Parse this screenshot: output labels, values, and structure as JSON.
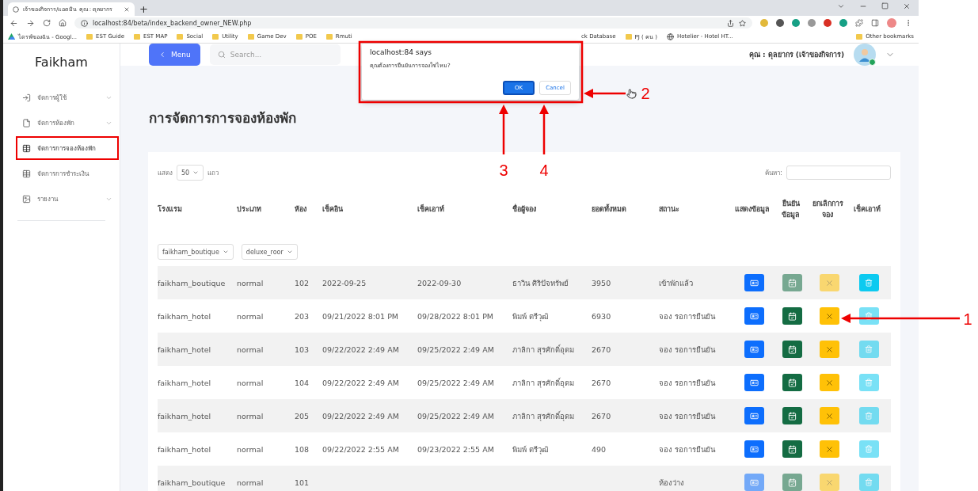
{
  "browser": {
    "tab_title": "เจ้าของกิจการ/แอดมิน คุณ : ดุลยากร",
    "new_tab": "+",
    "url": "localhost:84/beta/index_backend_owner_NEW.php",
    "bookmarks_left": [
      {
        "kind": "drive",
        "label": "ไดรฟ์ของฉัน - Googl..."
      },
      {
        "kind": "folder",
        "label": "EST Guide"
      },
      {
        "kind": "folder",
        "label": "EST MAP"
      },
      {
        "kind": "folder",
        "label": "Social"
      },
      {
        "kind": "folder",
        "label": "Utility"
      },
      {
        "kind": "folder",
        "label": "Game Dev"
      },
      {
        "kind": "folder",
        "label": "POE"
      },
      {
        "kind": "folder",
        "label": "Rmuti"
      }
    ],
    "bookmarks_right": [
      {
        "kind": "plain",
        "label": "ck Database"
      },
      {
        "kind": "folder",
        "label": "PJ ( คน )"
      },
      {
        "kind": "globe",
        "label": "Hotelier - Hotel HT..."
      }
    ],
    "other_bookmarks": "Other bookmarks"
  },
  "sidebar": {
    "brand": "Faikham",
    "items": [
      {
        "kind": "login",
        "label": "จัดการผู้ใช้",
        "has_submenu": true,
        "selected": false
      },
      {
        "kind": "file",
        "label": "จัดการห้องพัก",
        "has_submenu": true,
        "selected": false
      },
      {
        "kind": "table",
        "label": "จัดการการจองห้องพัก",
        "has_submenu": false,
        "selected": true
      },
      {
        "kind": "table",
        "label": "จัดการการชำระเงิน",
        "has_submenu": false,
        "selected": false
      },
      {
        "kind": "report",
        "label": "รายงาน",
        "has_submenu": true,
        "selected": false
      }
    ]
  },
  "topbar": {
    "menu_button": "Menu",
    "search_placeholder": "Search...",
    "user": "คุณ : ดุลยากร (เจ้าของกิจการ)"
  },
  "page_title": "การจัดการการจองห้องพัก",
  "table_controls": {
    "show_label": "แสดง",
    "page_size": "50",
    "rows_label": "แถว",
    "search_label": "ค้นหา:"
  },
  "table": {
    "columns": [
      "โรงแรม",
      "ประเภท",
      "ห้อง",
      "เช็คอิน",
      "เช็คเอาท์",
      "ชื่อผู้จอง",
      "ยอดทั้งหมด",
      "สถานะ",
      "แสดงข้อมูล",
      "ยืนยันข้อมูล",
      "ยกเลิกการจอง",
      "เช็คเอาท์"
    ],
    "filters": [
      "faikham_boutique",
      "deluxe_roor"
    ],
    "rows": [
      {
        "hotel": "faikham_boutique",
        "type": "normal",
        "room": "102",
        "check_in": "2022-09-25",
        "check_out": "2022-09-30",
        "guest": "ธาวิน ศิริปัจทรัพย์",
        "total": "3950",
        "status": "เข้าพักแล้ว",
        "actions": [
          {
            "kind": "view",
            "disabled": false
          },
          {
            "kind": "confirm",
            "disabled": true
          },
          {
            "kind": "cancel",
            "disabled": true
          },
          {
            "kind": "delete",
            "disabled": false
          }
        ]
      },
      {
        "hotel": "faikham_hotel",
        "type": "normal",
        "room": "203",
        "check_in": "09/21/2022 8:01 PM",
        "check_out": "09/28/2022 8:01 PM",
        "guest": "พิมพ์ ตรีวุฒิ",
        "total": "6930",
        "status": "จอง รอการยืนยัน",
        "actions": [
          {
            "kind": "view",
            "disabled": false
          },
          {
            "kind": "confirm",
            "disabled": false
          },
          {
            "kind": "cancel",
            "disabled": false
          },
          {
            "kind": "delete",
            "disabled": true
          }
        ]
      },
      {
        "hotel": "faikham_hotel",
        "type": "normal",
        "room": "103",
        "check_in": "09/22/2022 2:49 AM",
        "check_out": "09/25/2022 2:49 AM",
        "guest": "ภาลิกา สุรศักดิ์อุดม",
        "total": "2670",
        "status": "จอง รอการยืนยัน",
        "actions": [
          {
            "kind": "view",
            "disabled": false
          },
          {
            "kind": "confirm",
            "disabled": false
          },
          {
            "kind": "cancel",
            "disabled": false
          },
          {
            "kind": "delete",
            "disabled": true
          }
        ]
      },
      {
        "hotel": "faikham_hotel",
        "type": "normal",
        "room": "104",
        "check_in": "09/22/2022 2:49 AM",
        "check_out": "09/25/2022 2:49 AM",
        "guest": "ภาลิกา สุรศักดิ์อุดม",
        "total": "2670",
        "status": "จอง รอการยืนยัน",
        "actions": [
          {
            "kind": "view",
            "disabled": false
          },
          {
            "kind": "confirm",
            "disabled": false
          },
          {
            "kind": "cancel",
            "disabled": false
          },
          {
            "kind": "delete",
            "disabled": true
          }
        ]
      },
      {
        "hotel": "faikham_hotel",
        "type": "normal",
        "room": "205",
        "check_in": "09/22/2022 2:49 AM",
        "check_out": "09/25/2022 2:49 AM",
        "guest": "ภาลิกา สุรศักดิ์อุดม",
        "total": "2670",
        "status": "จอง รอการยืนยัน",
        "actions": [
          {
            "kind": "view",
            "disabled": false
          },
          {
            "kind": "confirm",
            "disabled": false
          },
          {
            "kind": "cancel",
            "disabled": false
          },
          {
            "kind": "delete",
            "disabled": true
          }
        ]
      },
      {
        "hotel": "faikham_hotel",
        "type": "normal",
        "room": "108",
        "check_in": "09/22/2022 2:55 AM",
        "check_out": "09/23/2022 2:55 AM",
        "guest": "พิมพ์ ตรีวุฒิ",
        "total": "490",
        "status": "จอง รอการยืนยัน",
        "actions": [
          {
            "kind": "view",
            "disabled": false
          },
          {
            "kind": "confirm",
            "disabled": false
          },
          {
            "kind": "cancel",
            "disabled": false
          },
          {
            "kind": "delete",
            "disabled": true
          }
        ]
      },
      {
        "hotel": "faikham_boutique",
        "type": "normal",
        "room": "101",
        "check_in": "",
        "check_out": "",
        "guest": "",
        "total": "",
        "status": "ห้องว่าง",
        "actions": [
          {
            "kind": "view",
            "disabled": true
          },
          {
            "kind": "confirm",
            "disabled": true
          },
          {
            "kind": "cancel",
            "disabled": true
          },
          {
            "kind": "delete",
            "disabled": true
          }
        ]
      }
    ]
  },
  "dialog": {
    "origin": "localhost:84 says",
    "message": "คุณต้องการยืนยันการจองใช่ไหม?",
    "ok": "OK",
    "cancel": "Cancel"
  },
  "annotations": [
    {
      "kind": "left",
      "label": "1"
    },
    {
      "kind": "dialog",
      "label": "2"
    },
    {
      "kind": "up-ok",
      "label": "3"
    },
    {
      "kind": "up-cancel",
      "label": "4"
    }
  ]
}
